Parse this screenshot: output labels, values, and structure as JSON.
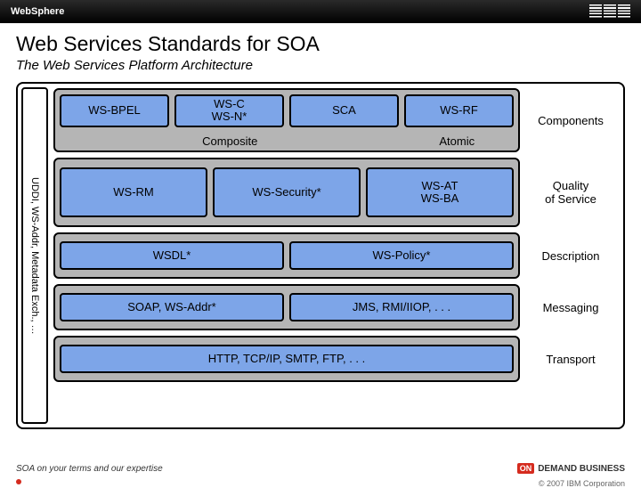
{
  "topbar": {
    "product": "WebSphere"
  },
  "title": "Web Services Standards for SOA",
  "subtitle": "The Web Services Platform Architecture",
  "sidebar": "UDDI, WS-Addr, Metadata Exch., …",
  "rows": {
    "components": {
      "label": "Components",
      "top": [
        "WS-BPEL",
        "WS-C\nWS-N*",
        "SCA",
        "WS-RF"
      ],
      "bottom": {
        "composite": "Composite",
        "atomic": "Atomic"
      }
    },
    "qos": {
      "label": "Quality\nof Service",
      "items": [
        "WS-RM",
        "WS-Security*",
        "WS-AT\nWS-BA"
      ]
    },
    "description": {
      "label": "Description",
      "items": [
        "WSDL*",
        "WS-Policy*"
      ]
    },
    "messaging": {
      "label": "Messaging",
      "items": [
        "SOAP, WS-Addr*",
        "JMS, RMI/IIOP, . . ."
      ]
    },
    "transport": {
      "label": "Transport",
      "items": [
        "HTTP, TCP/IP, SMTP, FTP, . . ."
      ]
    }
  },
  "footer": {
    "tagline": "SOA on your terms and our expertise",
    "ondemand_on": "ON",
    "ondemand_text": "DEMAND BUSINESS",
    "copyright": "© 2007 IBM Corporation"
  }
}
